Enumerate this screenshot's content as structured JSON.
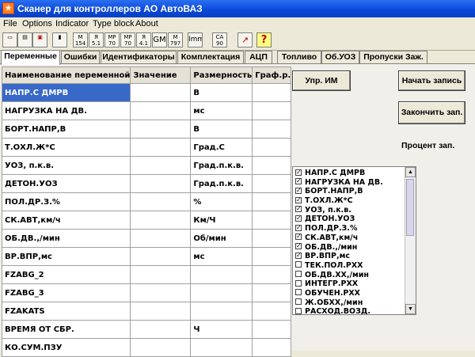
{
  "window": {
    "title": "Сканер для  контроллеров АО АвтоВАЗ"
  },
  "menu": [
    "File",
    "Options",
    "Indicator",
    "Type block",
    "About"
  ],
  "toolbar": [
    {
      "icon": "new-file-icon",
      "label": ""
    },
    {
      "icon": "open-file-icon",
      "label": ""
    },
    {
      "icon": "save-file-icon",
      "label": ""
    },
    {
      "icon": "device-icon",
      "label": ""
    },
    {
      "icon": "m154-icon",
      "label": "M 154"
    },
    {
      "icon": "ya51-icon",
      "label": "Я 5.1"
    },
    {
      "icon": "mp70-icon",
      "label": "MP 70"
    },
    {
      "icon": "mp70b-icon",
      "label": "MP 70"
    },
    {
      "icon": "ya41-icon",
      "label": "Я 4.1"
    },
    {
      "icon": "gm-icon",
      "label": "GM"
    },
    {
      "icon": "m797-icon",
      "label": "M 797"
    },
    {
      "icon": "imm-icon",
      "label": "Imm"
    },
    {
      "icon": "ca90-icon",
      "label": "CA 90"
    },
    {
      "icon": "chart-icon",
      "label": ""
    },
    {
      "icon": "help-icon",
      "label": "?"
    }
  ],
  "tabs": [
    "Переменные",
    "Ошибки",
    "Идентификаторы",
    "Комплектация",
    "АЦП",
    "Топливо",
    "Об.УОЗ",
    "Пропуски Заж."
  ],
  "grid": {
    "headers": [
      "Наименование переменной",
      "Значение",
      "Размерность",
      "Граф.р."
    ],
    "rows": [
      [
        "НАПР.С ДМРВ",
        "",
        "В",
        ""
      ],
      [
        "НАГРУЗКА НА ДВ.",
        "",
        "мс",
        ""
      ],
      [
        "БОРТ.НАПР,В",
        "",
        "В",
        ""
      ],
      [
        "Т.ОХЛ.Ж*С",
        "",
        "Град.С",
        ""
      ],
      [
        "УОЗ, п.к.в.",
        "",
        "Град.п.к.в.",
        ""
      ],
      [
        "ДЕТОН.УОЗ",
        "",
        "Град.п.к.в.",
        ""
      ],
      [
        "ПОЛ.ДР.З.%",
        "",
        "%",
        ""
      ],
      [
        "СК.АВТ,км/ч",
        "",
        "Км/Ч",
        ""
      ],
      [
        "ОБ.ДВ.,/мин",
        "",
        "Об/мин",
        ""
      ],
      [
        "ВР.ВПР,мс",
        "",
        "мс",
        ""
      ],
      [
        "FZABG_2",
        "",
        "",
        ""
      ],
      [
        "FZABG_3",
        "",
        "",
        ""
      ],
      [
        "FZAKATS",
        "",
        "",
        ""
      ],
      [
        "ВРЕМЯ ОТ СБР.",
        "",
        "Ч",
        ""
      ],
      [
        "КО.СУМ.ПЗУ",
        "",
        "",
        ""
      ]
    ]
  },
  "buttons": {
    "upr_im": "Упр. ИМ",
    "start_record": "Начать запись",
    "stop_record": "Закончить зап."
  },
  "percent_label": "Процент зап.",
  "checklist": [
    {
      "label": "НАПР.С ДМРВ",
      "checked": true
    },
    {
      "label": "НАГРУЗКА НА ДВ.",
      "checked": true
    },
    {
      "label": "БОРТ.НАПР,В",
      "checked": true
    },
    {
      "label": "Т.ОХЛ.Ж*С",
      "checked": true
    },
    {
      "label": "УОЗ, п.к.в.",
      "checked": true
    },
    {
      "label": "ДЕТОН.УОЗ",
      "checked": true
    },
    {
      "label": "ПОЛ.ДР.З.%",
      "checked": true
    },
    {
      "label": "СК.АВТ,км/ч",
      "checked": true
    },
    {
      "label": "ОБ.ДВ.,/мин",
      "checked": true
    },
    {
      "label": "ВР.ВПР,мс",
      "checked": true
    },
    {
      "label": "ТЕК.ПОЛ.РХХ",
      "checked": false
    },
    {
      "label": "ОБ.ДВ.ХХ,/мин",
      "checked": false
    },
    {
      "label": "ИНТЕГР.РХХ",
      "checked": false
    },
    {
      "label": "ОБУЧЕН.РХХ",
      "checked": false
    },
    {
      "label": "Ж.ОБХХ,/мин",
      "checked": false
    },
    {
      "label": "РАСХОД.ВОЗД.",
      "checked": false
    }
  ]
}
